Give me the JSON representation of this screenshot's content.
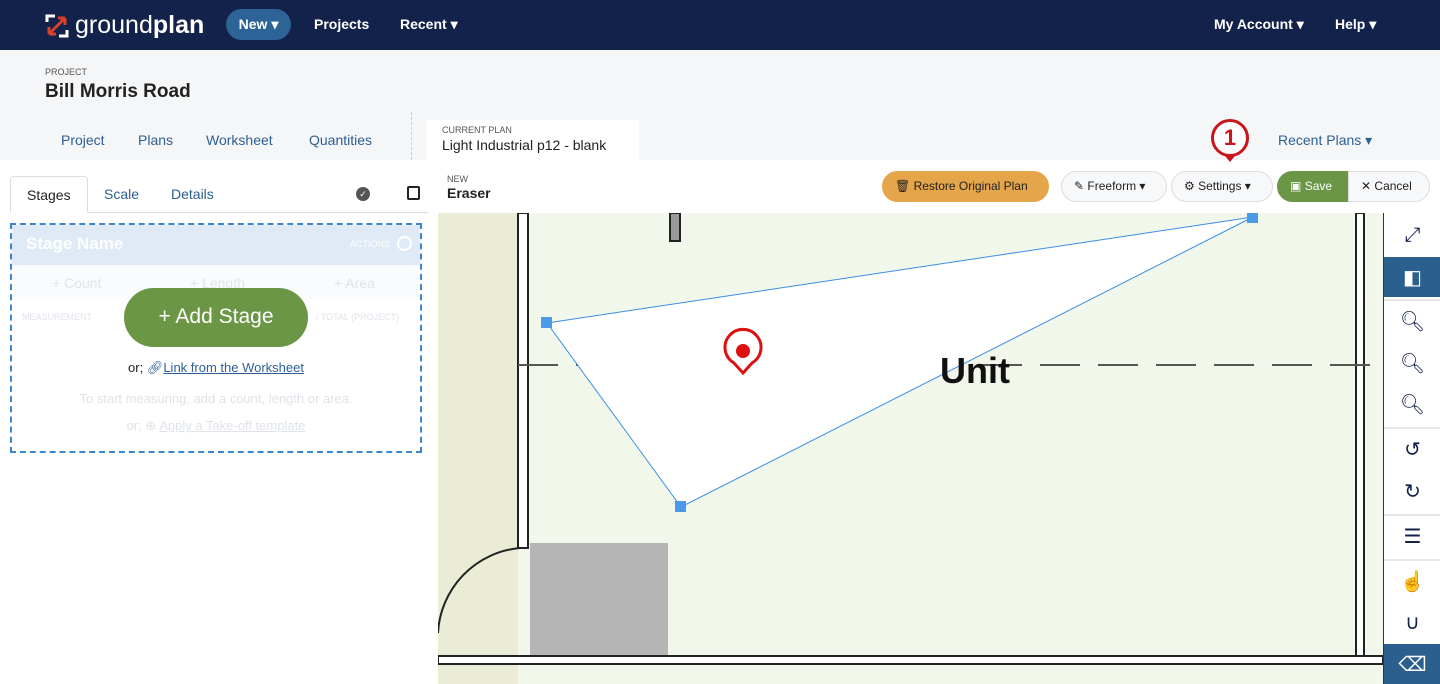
{
  "nav": {
    "brand_light": "ground",
    "brand_bold": "plan",
    "new": "New",
    "projects": "Projects",
    "recent": "Recent",
    "account": "My Account",
    "help": "Help"
  },
  "project": {
    "label": "PROJECT",
    "title": "Bill Morris Road",
    "tabs": [
      "Project",
      "Plans",
      "Worksheet",
      "Quantities"
    ]
  },
  "current_plan": {
    "label": "CURRENT PLAN",
    "name": "Light Industrial p12 - blank"
  },
  "recent_plans": "Recent Plans",
  "left": {
    "tabs": [
      "Stages",
      "Scale",
      "Details"
    ],
    "stage_name": "Stage Name",
    "actions": "ACTIONS",
    "count": "+ Count",
    "length": "+ Length",
    "area": "+ Area",
    "measurement": "MEASUREMENT",
    "total": "/ TOTAL (PROJECT)",
    "add_stage": "+ Add Stage",
    "or": "or;",
    "link_worksheet": "Link from the Worksheet",
    "hint": "To start measuring, add a count, length or area.",
    "apply_template": "Apply a Take-off template"
  },
  "toolbar": {
    "mode_label": "NEW",
    "mode": "Eraser",
    "restore": "Restore Original Plan",
    "freeform": "Freeform",
    "settings": "Settings",
    "save": "Save",
    "cancel": "Cancel",
    "callout": "1"
  },
  "plan": {
    "room_label": "Unit"
  },
  "colors": {
    "nav": "#13224a",
    "accent": "#2d5f93",
    "save": "#6a9645",
    "restore": "#e5a54a",
    "callout": "#c8161d"
  },
  "rail_icons": [
    "expand-icon",
    "panel-toggle-icon",
    "zoom-in-icon",
    "zoom-out-icon",
    "zoom-fit-icon",
    "undo-icon",
    "redo-icon",
    "list-icon",
    "pointer-icon",
    "snap-magnet-icon",
    "eraser-icon"
  ]
}
